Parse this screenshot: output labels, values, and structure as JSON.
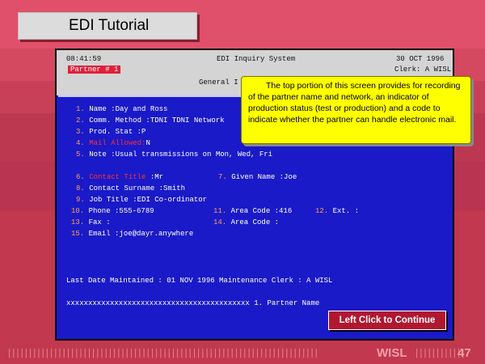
{
  "slide": {
    "title": "EDI Tutorial",
    "page_number": "47",
    "footer_brand": "WISL"
  },
  "terminal": {
    "time": "08:41:59",
    "system_name": "EDI Inquiry System",
    "date": "30 OCT 1996",
    "partner_badge": "Partner # 1",
    "clerk": "Clerk: A WISL",
    "subtitle_prefix": "General I",
    "fields": [
      {
        "num": "1.",
        "label": "Name         :",
        "value": "Day and Ross",
        "red": false
      },
      {
        "num": "2.",
        "label": "Comm. Method :",
        "value": "TDNI TDNI Network",
        "red": false
      },
      {
        "num": "3.",
        "label": "Prod. Stat   :",
        "value": "P",
        "red": false
      },
      {
        "num": "4.",
        "label": "Mail Allowed:",
        "value": "N",
        "red": true
      },
      {
        "num": "5.",
        "label": "Note         :",
        "value": "Usual transmissions on Mon, Wed, Fri",
        "red": false
      }
    ],
    "contact": {
      "f6_num": "6.",
      "f6_label": "Contact Title",
      "f6_value": ":Mr",
      "f7_num": "7.",
      "f7_label": "Given Name",
      "f7_value": ":Joe",
      "f8_num": "8.",
      "f8_label": "Contact Surname :",
      "f8_value": "Smith",
      "f9_num": "9.",
      "f9_label": "Job Title       :",
      "f9_value": "EDI Co-ordinator",
      "f10_num": "10.",
      "f10_label": "Phone :",
      "f10_value": "555-6789",
      "f11_num": "11.",
      "f11_label": "Area Code :",
      "f11_value": "416",
      "f12_num": "12.",
      "f12_label": "Ext. :",
      "f12_value": "",
      "f13_num": "13.",
      "f13_label": "Fax   :",
      "f13_value": "",
      "f14_num": "14.",
      "f14_label": "Area Code :",
      "f14_value": "",
      "f15_num": "15.",
      "f15_label": "Email :",
      "f15_value": "joe@dayr.anywhere"
    },
    "maintenance": "Last Date Maintained : 01 NOV 1996 Maintenance Clerk : A WISL",
    "menu_line": "xxxxxxxxxxxxxxxxxxxxxxxxxxxxxxxxxxxxxxxxxx 1. Partner Name"
  },
  "callout": {
    "text": "The top portion of this screen provides for recording of the partner name and network, an indicator of production status (test or production) and a code to indicate whether the partner can handle electronic mail."
  },
  "continue_button": "Left Click to Continue",
  "colors": {
    "background": "#c2384e",
    "terminal_blue": "#1a1ac8",
    "callout_yellow": "#ffff00",
    "button_red": "#b01830"
  }
}
